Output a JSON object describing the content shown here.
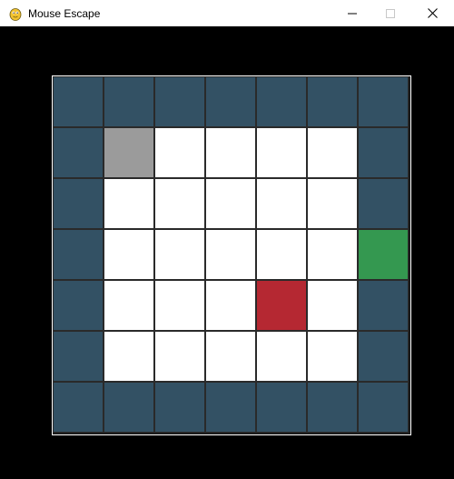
{
  "window": {
    "title": "Mouse Escape",
    "icon": "pygame-snake-icon",
    "controls": [
      "minimize-icon",
      "maximize-icon",
      "close-icon"
    ]
  },
  "colors": {
    "background": "#000000",
    "wall": "#335164",
    "floor": "#ffffff",
    "mouse": "#9b9b9b",
    "cat": "#b52832",
    "exit": "#349850",
    "board_border": "#ffffff"
  },
  "board": {
    "rows": 7,
    "cols": 7,
    "legend": {
      "W": "wall",
      ".": "floor",
      "M": "mouse",
      "C": "cat",
      "E": "exit"
    },
    "grid": [
      [
        "W",
        "W",
        "W",
        "W",
        "W",
        "W",
        "W"
      ],
      [
        "W",
        "M",
        ".",
        ".",
        ".",
        ".",
        "W"
      ],
      [
        "W",
        ".",
        ".",
        ".",
        ".",
        ".",
        "W"
      ],
      [
        "W",
        ".",
        ".",
        ".",
        ".",
        ".",
        "E"
      ],
      [
        "W",
        ".",
        ".",
        ".",
        "C",
        ".",
        "W"
      ],
      [
        "W",
        ".",
        ".",
        ".",
        ".",
        ".",
        "W"
      ],
      [
        "W",
        "W",
        "W",
        "W",
        "W",
        "W",
        "W"
      ]
    ]
  }
}
